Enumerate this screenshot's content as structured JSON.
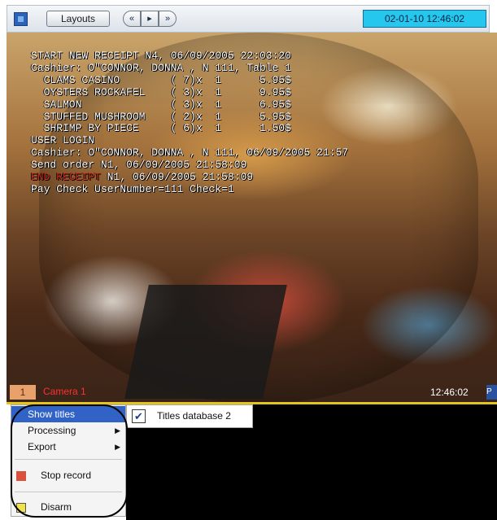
{
  "toolbar": {
    "layouts_label": "Layouts",
    "nav_prev": "«",
    "nav_play": "▸",
    "nav_next": "»",
    "datetime": "02-01-10   12:46:02"
  },
  "video": {
    "receipt_lines": [
      {
        "text": "START NEW RECEIPT N4, 06/09/2005 22:03:20",
        "color": "#ffffff"
      },
      {
        "text": "Cashier: O\"CONNOR, DONNA , N 111, Table 1",
        "color": "#ffffff"
      },
      {
        "text": "  CLAMS CASINO        ( 7)x  1      5.95$",
        "color": "#ffffff"
      },
      {
        "text": "  OYSTERS ROCKAFEL    ( 3)x  1      9.95$",
        "color": "#ffffff"
      },
      {
        "text": "  SALMON              ( 3)x  1      6.95$",
        "color": "#ffffff"
      },
      {
        "text": "  STUFFED MUSHROOM    ( 2)x  1      5.95$",
        "color": "#ffffff"
      },
      {
        "text": "  SHRIMP BY PIECE     ( 6)x  1      1.50$",
        "color": "#ffffff"
      },
      {
        "text": "USER LOGIN",
        "color": "#ffffff"
      },
      {
        "text": "Cashier: O\"CONNOR, DONNA , N 111, 06/09/2005 21:57",
        "color": "#ffffff"
      },
      {
        "text": "Send order N1, 06/09/2005 21:58:09",
        "color": "#ffffff"
      },
      {
        "text": "END RECEIPT N1, 06/09/2005 21:58:09",
        "color": "#e0301c",
        "red_prefix": "END RECEIPT",
        "rest": " N1, 06/09/2005 21:58:09"
      },
      {
        "text": "Pay Check UserNumber=111 Check=1",
        "color": "#ffffff"
      }
    ],
    "camera_number": "1",
    "camera_name": "Camera 1",
    "camera_time": "12:46:02",
    "corner_label": "P"
  },
  "context_menu": {
    "items": [
      {
        "label": "Show titles",
        "selected": true,
        "has_submenu": false
      },
      {
        "label": "Processing",
        "has_submenu": true
      },
      {
        "label": "Export",
        "has_submenu": true
      },
      {
        "label": "Stop record",
        "icon": "stop-record-icon"
      },
      {
        "label": "Disarm",
        "icon": "disarm-icon"
      }
    ],
    "submenu_arrow": "▶"
  },
  "submenu": {
    "item_label": "Titles database 2",
    "checked": true,
    "check_glyph": "✔"
  },
  "colors": {
    "datetime_bg": "#25c7ee",
    "menu_selected": "#3162c6",
    "stop_record": "#d9503d",
    "disarm": "#f2e24a",
    "highlight_bar": "#e5c420"
  }
}
